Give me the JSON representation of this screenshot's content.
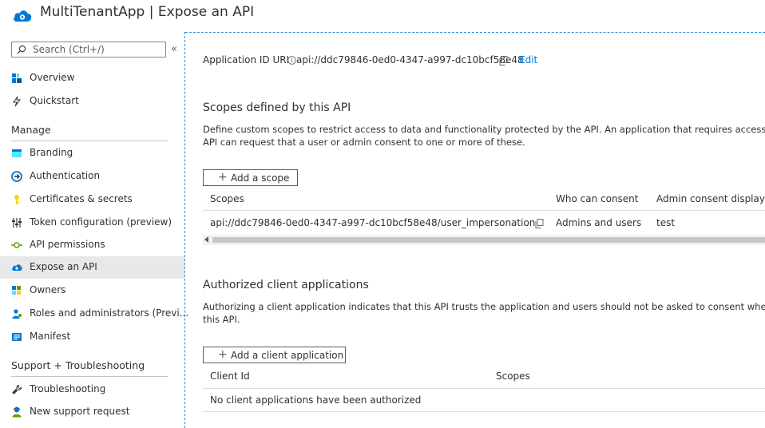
{
  "header": {
    "title": "MultiTenantApp | Expose an API",
    "app_icon": "cloud-gear-icon",
    "brand_color": "#0078d4"
  },
  "sidebar": {
    "search_placeholder": "Search (Ctrl+/)",
    "collapse_glyph": "«",
    "top_items": [
      {
        "label": "Overview",
        "icon": "overview-icon"
      },
      {
        "label": "Quickstart",
        "icon": "lightning-icon"
      }
    ],
    "manage_header": "Manage",
    "manage_items": [
      {
        "label": "Branding",
        "icon": "branding-icon"
      },
      {
        "label": "Authentication",
        "icon": "authentication-icon"
      },
      {
        "label": "Certificates & secrets",
        "icon": "key-icon"
      },
      {
        "label": "Token configuration (preview)",
        "icon": "token-bars-icon"
      },
      {
        "label": "API permissions",
        "icon": "api-permissions-icon"
      },
      {
        "label": "Expose an API",
        "icon": "cloud-icon",
        "active": true
      },
      {
        "label": "Owners",
        "icon": "owners-icon"
      },
      {
        "label": "Roles and administrators (Previ...",
        "icon": "roles-icon"
      },
      {
        "label": "Manifest",
        "icon": "manifest-icon"
      }
    ],
    "support_header": "Support + Troubleshooting",
    "support_items": [
      {
        "label": "Troubleshooting",
        "icon": "wrench-icon"
      },
      {
        "label": "New support request",
        "icon": "support-person-icon"
      }
    ]
  },
  "main": {
    "appid_label": "Application ID URI",
    "appid_value": "api://ddc79846-0ed0-4347-a997-dc10bcf58e48",
    "edit_label": "Edit",
    "scopes_title": "Scopes defined by this API",
    "scopes_desc_line1": "Define custom scopes to restrict access to data and functionality protected by the API. An application that requires access to parts of this",
    "scopes_desc_line2": "API can request that a user or admin consent to one or more of these.",
    "add_scope_label": "Add a scope",
    "scopes_table": {
      "headers": [
        "Scopes",
        "Who can consent",
        "Admin consent display na"
      ],
      "rows": [
        {
          "scope": "api://ddc79846-0ed0-4347-a997-dc10bcf58e48/user_impersonation",
          "who": "Admins and users",
          "display": "test"
        }
      ]
    },
    "clients_title": "Authorized client applications",
    "clients_desc_line1": "Authorizing a client application indicates that this API trusts the application and users should not be asked to consent when the client cal",
    "clients_desc_line2": "this API.",
    "add_client_label": "Add a client application",
    "clients_table": {
      "headers": [
        "Client Id",
        "Scopes"
      ],
      "empty_message": "No client applications have been authorized"
    }
  }
}
